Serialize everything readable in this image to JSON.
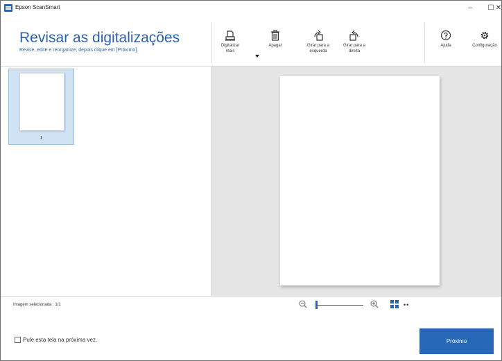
{
  "window": {
    "title": "Epson ScanSmart",
    "minimize": "–",
    "maximize": "☐",
    "close": "✕"
  },
  "header": {
    "title": "Revisar as digitalizações",
    "subtitle": "Revise, edite e reorganize, depois clique em [Próximo]."
  },
  "toolbar": {
    "scan_more": "Digitalizar\nmais",
    "delete": "Apagar",
    "rotate_left": "Girar para a\nesquerda",
    "rotate_right": "Girar para a\ndireita",
    "help": "Ajuda",
    "settings": "Configuração"
  },
  "icons": {
    "scan_more": "scanner-icon",
    "delete": "trash-icon",
    "rotate_left": "rotate-left-icon",
    "rotate_right": "rotate-right-icon",
    "help": "help-circle-icon",
    "settings": "gear-icon"
  },
  "thumbnails": [
    {
      "number": "1",
      "selected": true
    }
  ],
  "status": {
    "selected_image": "Imagem selecionada : 1/1",
    "zoom_level": 0.0
  },
  "footer": {
    "skip_checkbox_label": "Pule esta tela na próxima vez.",
    "skip_checked": false,
    "next_button": "Próximo"
  },
  "colors": {
    "accent": "#2a62b0",
    "next_button": "#2767b8",
    "selection": "#cfe3f4",
    "preview_background": "#e5e5e5"
  }
}
